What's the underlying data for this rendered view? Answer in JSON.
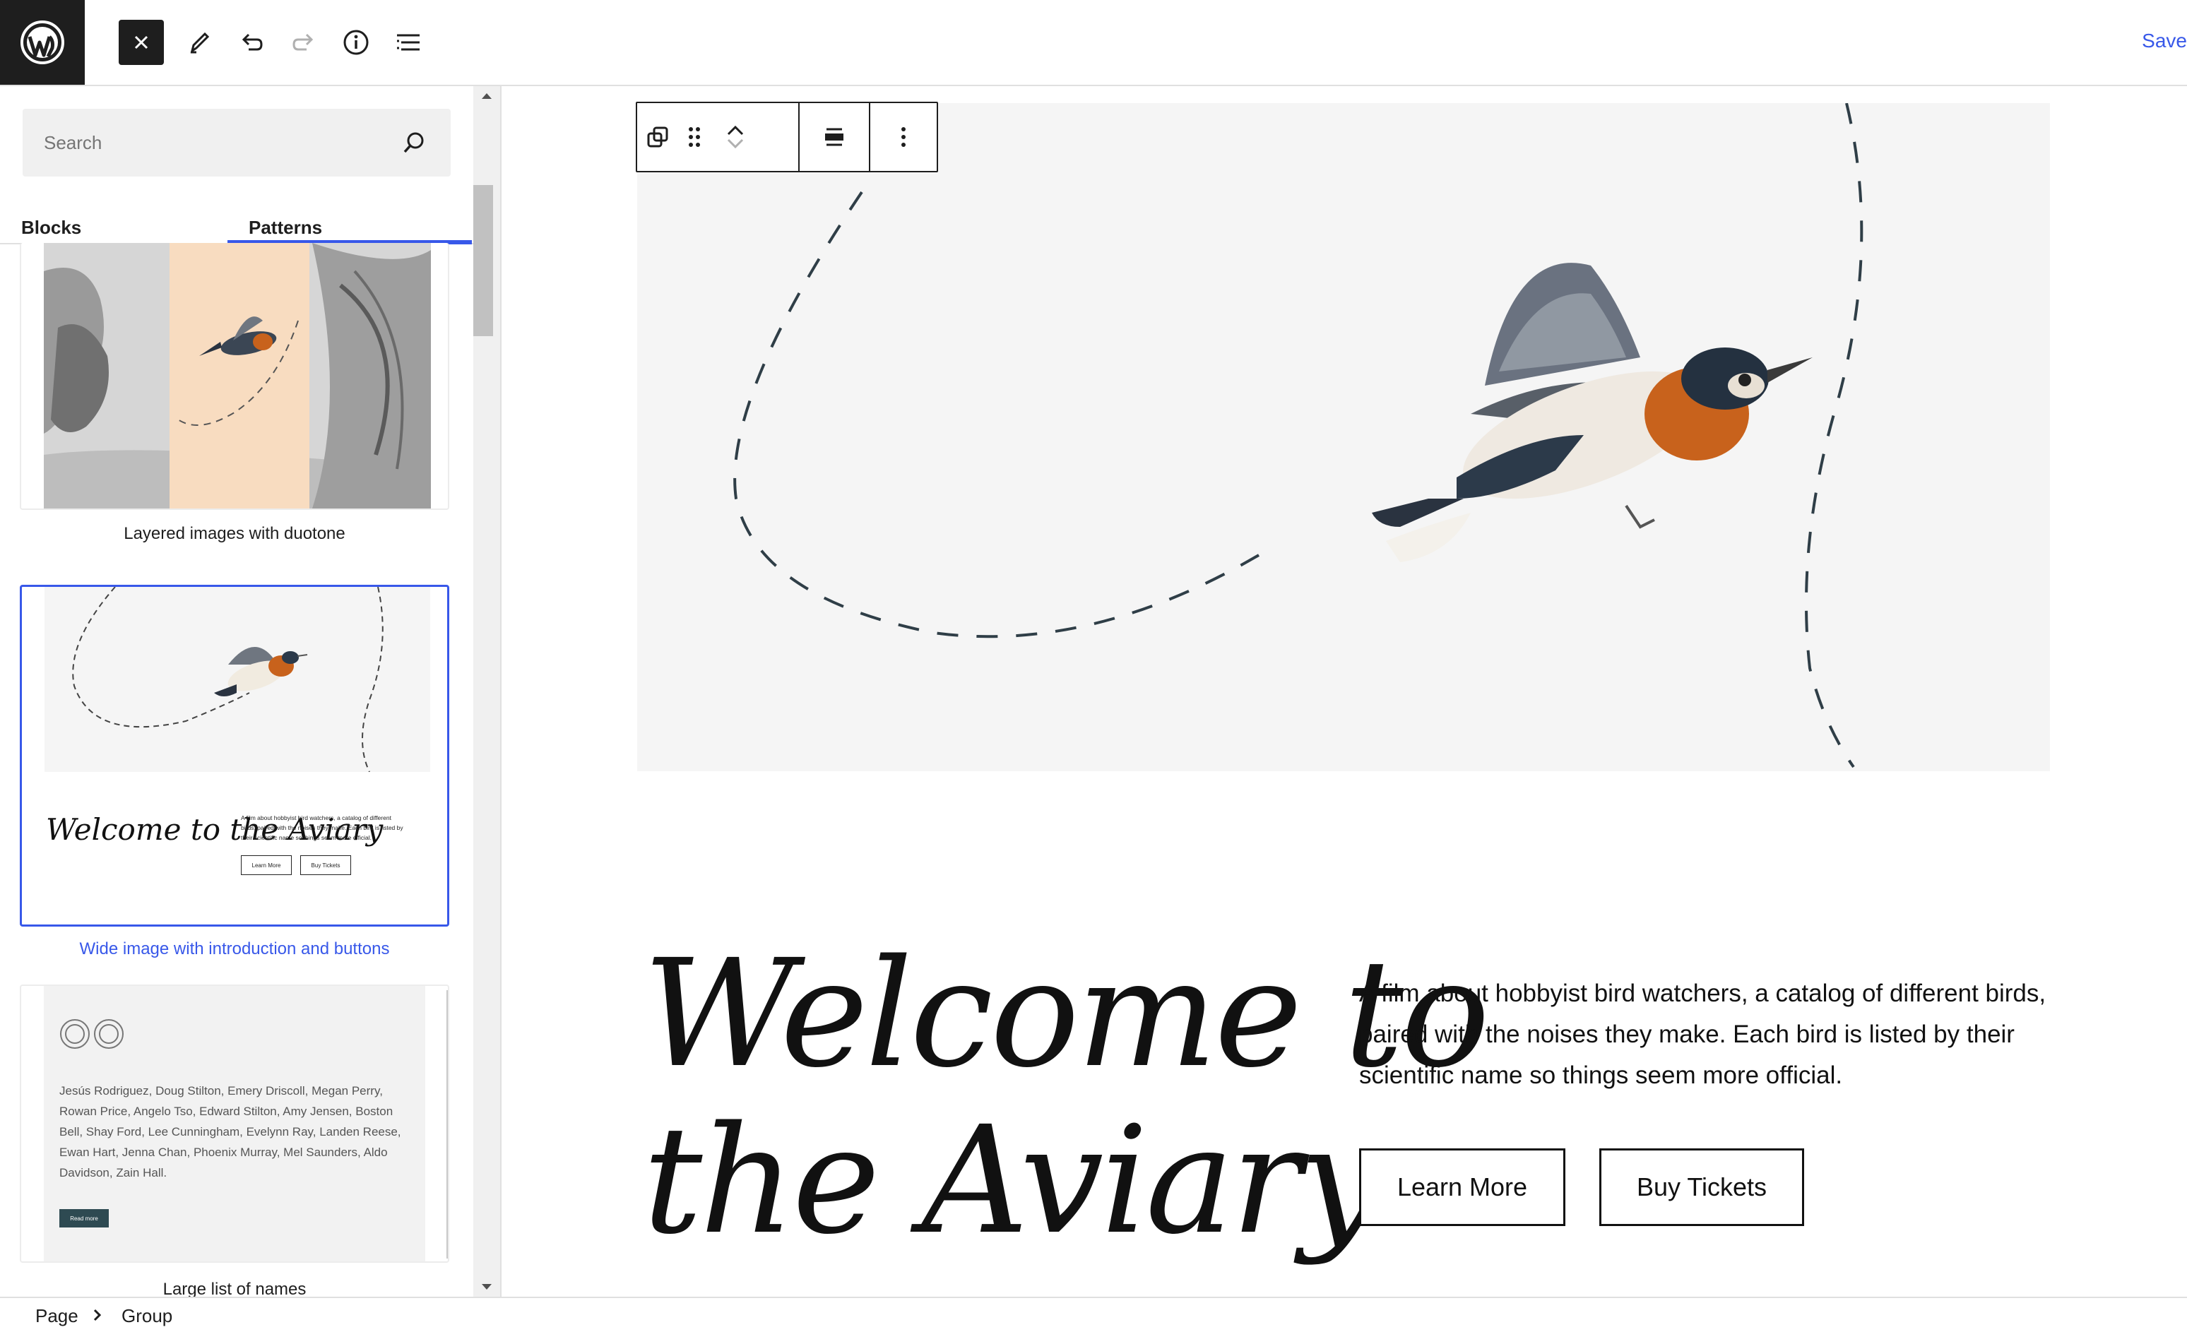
{
  "topbar": {
    "save_label": "Save",
    "icons": [
      "wordpress-logo",
      "close-icon",
      "pencil-icon",
      "undo-icon",
      "redo-icon",
      "info-icon",
      "list-view-icon"
    ]
  },
  "sidebar": {
    "search_placeholder": "Search",
    "tabs": [
      {
        "label": "Blocks"
      },
      {
        "label": "Patterns"
      }
    ],
    "active_tab": "Patterns",
    "patterns": [
      {
        "label": "Layered images with duotone"
      },
      {
        "label": "Wide image with introduction and buttons",
        "preview_title": "Welcome to the Aviary",
        "preview_text": "A film about hobbyist bird watchers, a catalog of different birds, paired with the noises they make. Each bird is listed by their scientific name so things seem more official.",
        "preview_btn1": "Learn More",
        "preview_btn2": "Buy Tickets"
      },
      {
        "label": "Large list of names",
        "preview_names": "Jesús Rodriguez, Doug Stilton, Emery Driscoll, Megan Perry, Rowan Price, Angelo Tso, Edward Stilton, Amy Jensen, Boston Bell, Shay Ford, Lee Cunningham, Evelynn Ray, Landen Reese, Ewan Hart, Jenna Chan, Phoenix Murray, Mel Saunders, Aldo Davidson, Zain Hall.",
        "preview_button": "Read more"
      }
    ]
  },
  "canvas": {
    "heading": "Welcome to\nthe Aviary",
    "intro": "A film about hobbyist bird watchers, a catalog of different birds, paired with the noises they make. Each bird is listed by their scientific name so things seem more official.",
    "buttons": [
      {
        "label": "Learn More"
      },
      {
        "label": "Buy Tickets"
      }
    ],
    "toolbar_icons": [
      "duplicate-icon",
      "drag-handle-icon",
      "move-up-icon",
      "move-down-icon",
      "align-icon",
      "more-options-icon"
    ]
  },
  "breadcrumb": [
    {
      "label": "Page"
    },
    {
      "label": "Group"
    }
  ],
  "colors": {
    "accent": "#3858e9",
    "dark": "#1e1e1e",
    "hero_bg": "#f5f5f5"
  }
}
